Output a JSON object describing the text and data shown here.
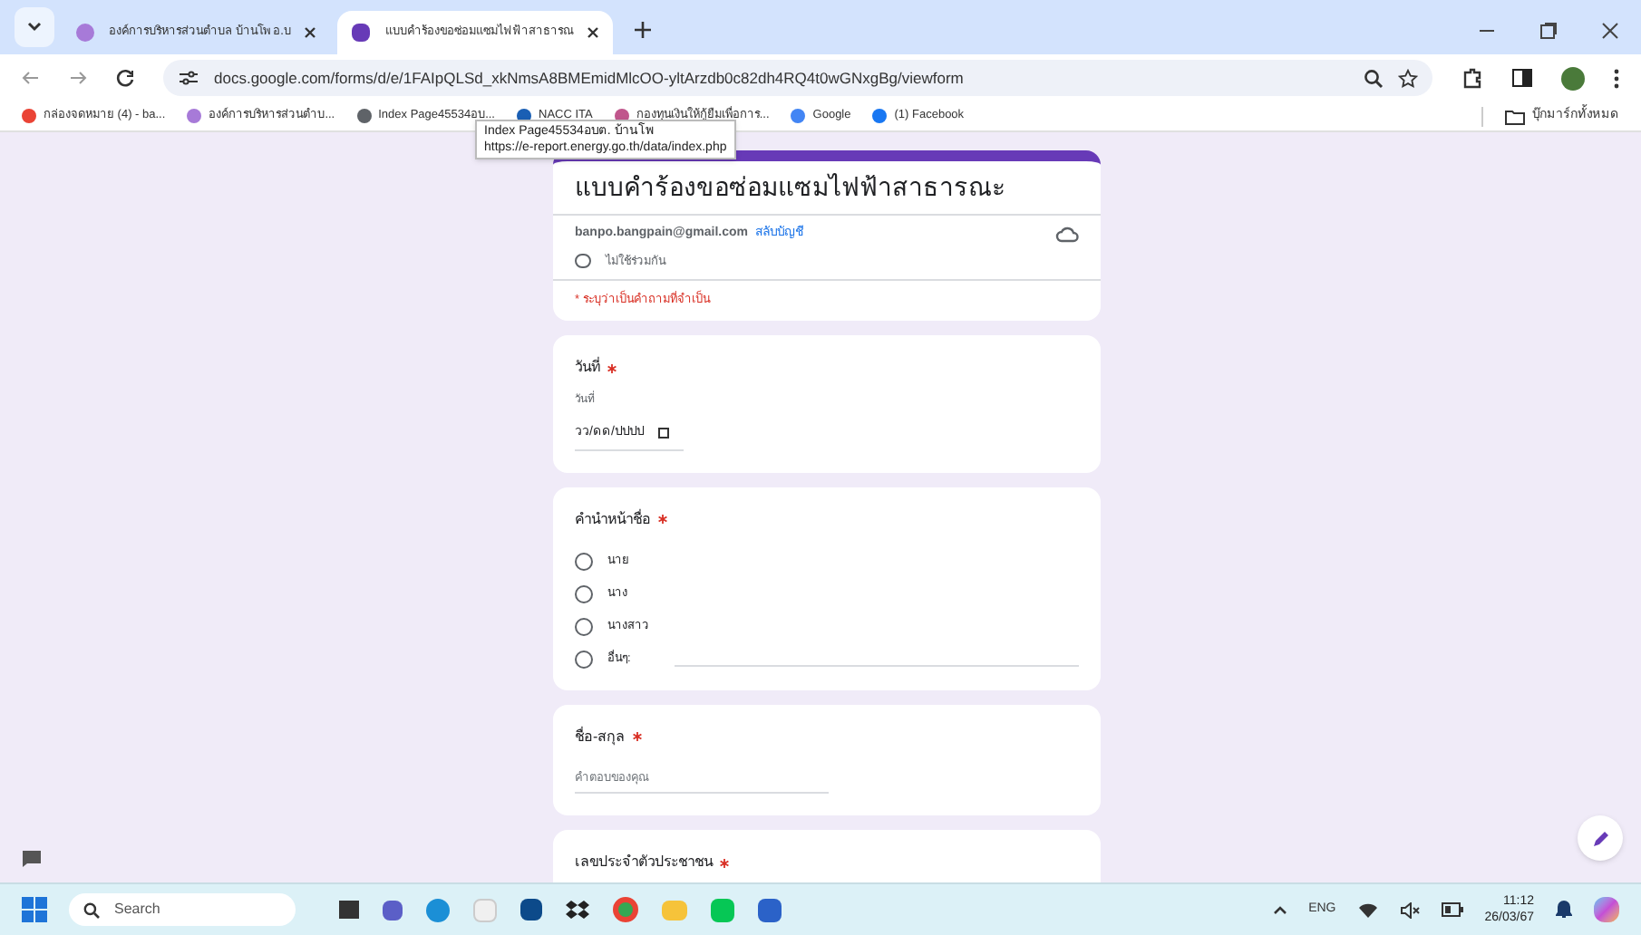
{
  "browser": {
    "tabs": [
      {
        "title": "องค์การบริหารส่วนตำบล บ้านโพ อ.บ",
        "selected": false
      },
      {
        "title": "แบบคำร้องขอซ่อมแซมไฟฟ้าสาธารณ",
        "selected": true
      }
    ],
    "url": "docs.google.com/forms/d/e/1FAIpQLSd_xkNmsA8BMEmidMlcOO-yltArzdb0c82dh4RQ4t0wGNxgBg/viewform",
    "bookmarks": [
      "กล่องจดหมาย (4) - ba...",
      "องค์การบริหารส่วนตำบ...",
      "Index Page45534อบ...",
      "NACC ITA",
      "กองทุนเงินให้กู้ยืมเพื่อการ...",
      "Google",
      "(1) Facebook"
    ],
    "all_bookmarks": "บุ๊กมาร์กทั้งหมด",
    "tooltip": {
      "title": "Index Page45534อบต. บ้านโพ",
      "url": "https://e-report.energy.go.th/data/index.php"
    }
  },
  "form": {
    "title": "แบบคำร้องขอซ่อมแซมไฟฟ้าสาธารณะ",
    "email": "banpo.bangpain@gmail.com",
    "switch_account": "สลับบัญชี",
    "not_shared": "ไม่ใช้ร่วมกัน",
    "required_note": "* ระบุว่าเป็นคำถามที่จำเป็น",
    "questions": [
      {
        "kind": "date",
        "label": "วันที่",
        "required": true,
        "sublabel": "วันที่",
        "placeholder": "วว/ดด/ปปปป"
      },
      {
        "kind": "radio",
        "label": "คำนำหน้าชื่อ",
        "required": true,
        "options": [
          {
            "label": "นาย",
            "selected": false,
            "kind": "plain"
          },
          {
            "label": "นาง",
            "selected": false,
            "kind": "plain"
          },
          {
            "label": "นางสาว",
            "selected": false,
            "kind": "plain"
          },
          {
            "label": "อื่นๆ:",
            "selected": false,
            "kind": "other"
          }
        ]
      },
      {
        "kind": "text",
        "label": "ชื่อ-สกุล",
        "required": true,
        "placeholder": "คำตอบของคุณ"
      },
      {
        "kind": "cut",
        "label": "เลขประจำตัวประชาชน",
        "required": true
      }
    ]
  },
  "taskbar": {
    "search": "Search",
    "language": "ENG",
    "time": "11:12",
    "date": "26/03/67"
  }
}
